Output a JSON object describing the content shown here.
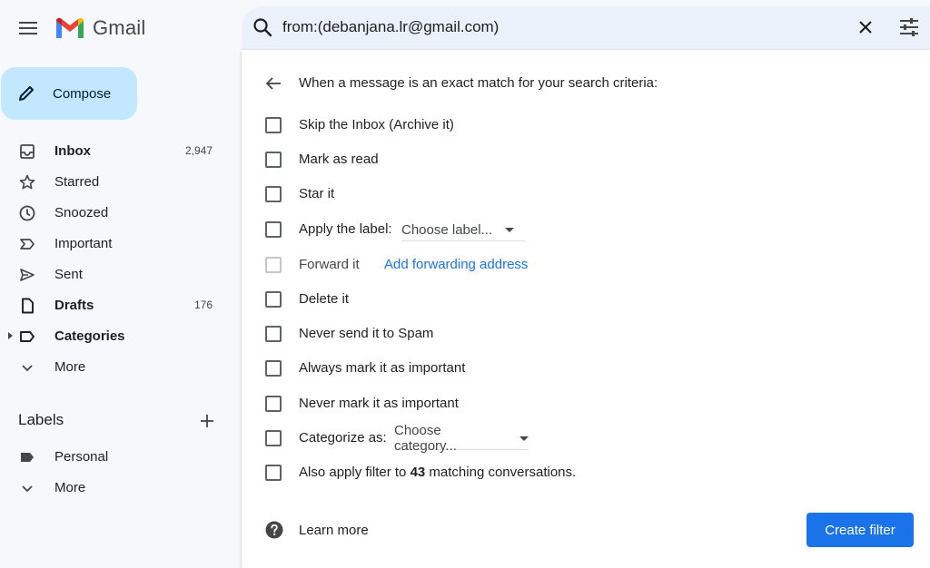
{
  "app": {
    "name": "Gmail"
  },
  "search": {
    "query": "from:(debanjana.lr@gmail.com)"
  },
  "sidebar": {
    "compose_label": "Compose",
    "items": [
      {
        "label": "Inbox",
        "count": "2,947",
        "bold": true,
        "icon": "inbox-icon"
      },
      {
        "label": "Starred",
        "count": "",
        "icon": "star-icon"
      },
      {
        "label": "Snoozed",
        "count": "",
        "icon": "clock-icon"
      },
      {
        "label": "Important",
        "count": "",
        "icon": "important-icon"
      },
      {
        "label": "Sent",
        "count": "",
        "icon": "send-icon"
      },
      {
        "label": "Drafts",
        "count": "176",
        "bold": true,
        "icon": "draft-icon"
      },
      {
        "label": "Categories",
        "count": "",
        "bold": true,
        "icon": "label-outline-icon"
      },
      {
        "label": "More",
        "count": "",
        "icon": "chevron-down-icon"
      }
    ],
    "labels_heading": "Labels",
    "labels": [
      {
        "label": "Personal",
        "icon": "label-icon"
      },
      {
        "label": "More",
        "icon": "chevron-down-icon"
      }
    ]
  },
  "filter": {
    "criteria_text": "When a message is an exact match for your search criteria:",
    "options": {
      "skip_inbox": "Skip the Inbox (Archive it)",
      "mark_read": "Mark as read",
      "star": "Star it",
      "apply_label": "Apply the label:",
      "apply_label_select": "Choose label...",
      "forward": "Forward it",
      "forward_link": "Add forwarding address",
      "delete": "Delete it",
      "never_spam": "Never send it to Spam",
      "always_important": "Always mark it as important",
      "never_important": "Never mark it as important",
      "categorize": "Categorize as:",
      "categorize_select": "Choose category...",
      "also_apply_pre": "Also apply filter to ",
      "also_apply_count": "43",
      "also_apply_post": " matching conversations."
    },
    "learn_more": "Learn more",
    "create_button": "Create filter"
  },
  "colors": {
    "accent": "#1a73e8",
    "compose_bg": "#c2e7ff",
    "search_bg": "#eaf1fb",
    "page_bg": "#f6f8fc"
  }
}
